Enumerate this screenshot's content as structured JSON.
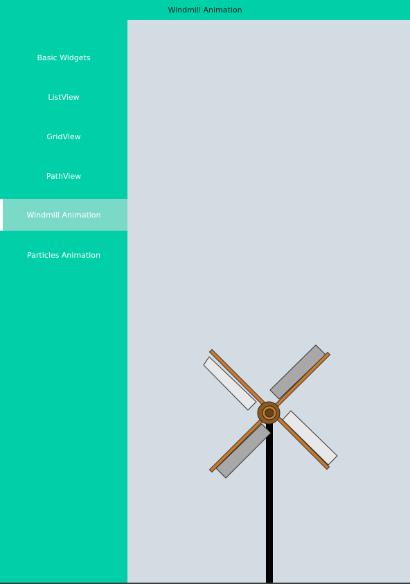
{
  "window": {
    "title": "Windmill Animation"
  },
  "sidebar": {
    "items": [
      {
        "label": "Basic Widgets",
        "active": false
      },
      {
        "label": "ListView",
        "active": false
      },
      {
        "label": "GridView",
        "active": false
      },
      {
        "label": "PathView",
        "active": false
      },
      {
        "label": "Windmill Animation",
        "active": true
      },
      {
        "label": "Particles Animation",
        "active": false
      }
    ]
  },
  "colors": {
    "accent": "#00cfa8",
    "active_item": "#7bd9c8",
    "canvas_bg": "#d3dbe3",
    "pole": "#000000",
    "arm": "#cc7a2a",
    "hub": "#8b5a1e",
    "sail_light": "#e8e8e8",
    "sail_dark": "#a8a8a8"
  }
}
